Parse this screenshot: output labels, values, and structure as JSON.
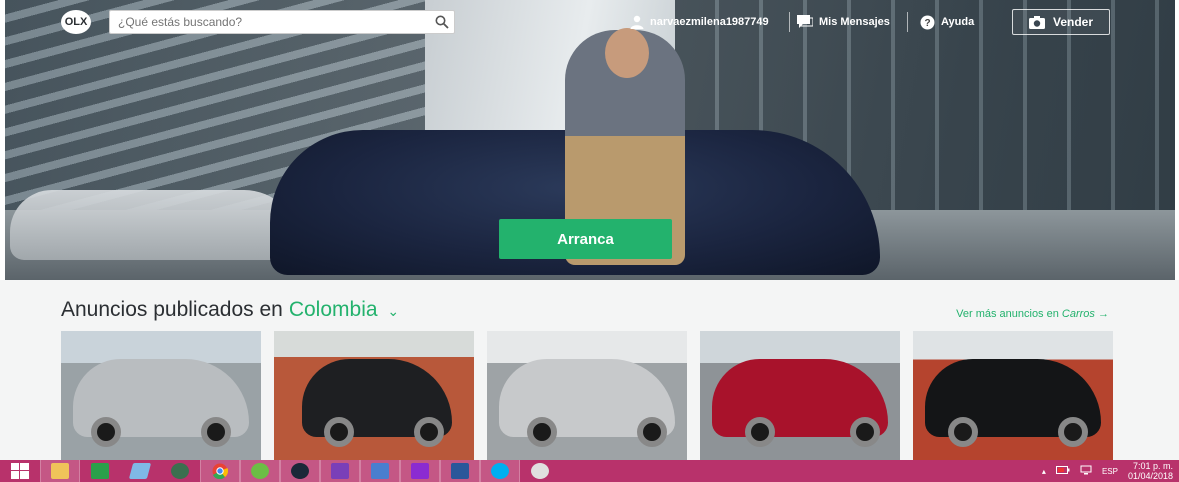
{
  "header": {
    "logo_text": "OLX",
    "search_placeholder": "¿Qué estás buscando?",
    "user_name": "narvaezmilena1987749",
    "messages_label": "Mis Mensajes",
    "help_label": "Ayuda",
    "sell_label": "Vender"
  },
  "hero": {
    "cta_label": "Arranca"
  },
  "listings": {
    "title_prefix": "Anuncios publicados en",
    "location": "Colombia",
    "more_prefix": "Ver más anuncios en",
    "more_category": "Carros",
    "more_arrow": "→",
    "cards": [
      {
        "car_color": "#b9bdc0"
      },
      {
        "car_color": "#1e1f22"
      },
      {
        "car_color": "#c7c9cb"
      },
      {
        "car_color": "#a8122b"
      },
      {
        "car_color": "#141517"
      }
    ]
  },
  "taskbar": {
    "apps": [
      "windows-start",
      "file-explorer",
      "store",
      "notes",
      "settings-gear",
      "chrome",
      "utorrent",
      "steam",
      "app-settings",
      "messenger",
      "search-app",
      "word",
      "skype",
      "paint"
    ],
    "language": "ESP",
    "time": "7:01 p. m.",
    "date": "01/04/2018"
  },
  "colors": {
    "brand_green": "#23b26d",
    "taskbar": "#b8326b"
  }
}
